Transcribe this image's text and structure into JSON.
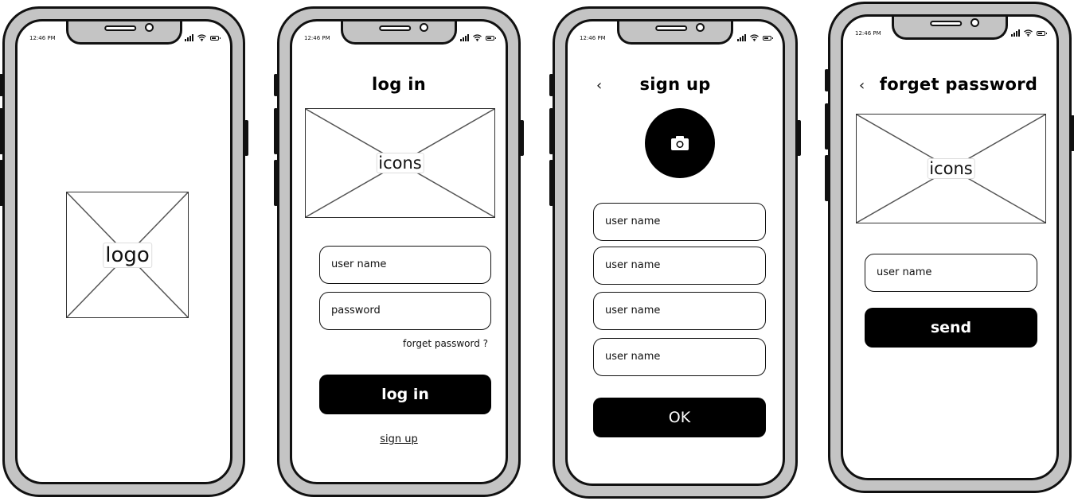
{
  "status_bar": {
    "time": "12:46 PM"
  },
  "screens": {
    "splash": {
      "logo_label": "logo"
    },
    "login": {
      "title": "log in",
      "image_label": "icons",
      "username_placeholder": "user name",
      "password_placeholder": "password",
      "forgot_link": "forget password ?",
      "login_button": "log in",
      "signup_link": "sign up"
    },
    "signup": {
      "back_glyph": "‹",
      "title": "sign up",
      "fields": [
        "user name",
        "user name",
        "user name",
        "user name"
      ],
      "ok_button": "OK"
    },
    "forgot": {
      "back_glyph": "‹",
      "title": "forget password",
      "image_label": "icons",
      "username_placeholder": "user name",
      "send_button": "send"
    }
  }
}
